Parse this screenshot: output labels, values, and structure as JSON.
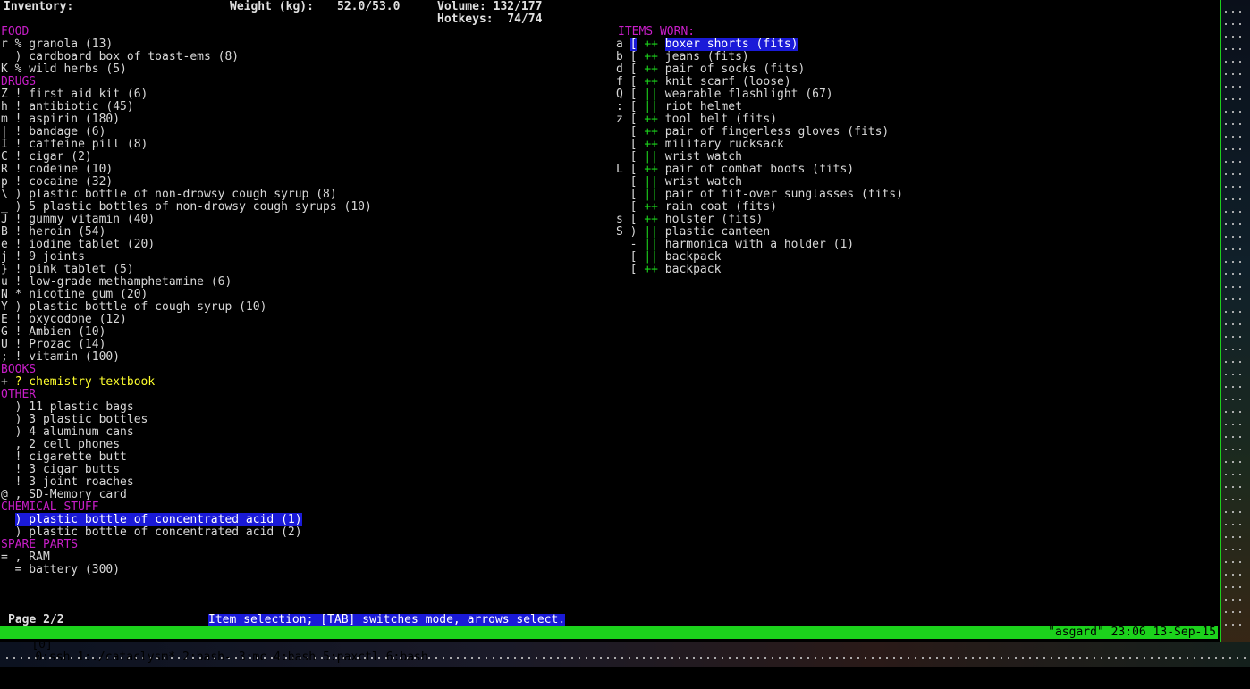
{
  "header": {
    "title": "Inventory:",
    "weight_label": "Weight (kg):",
    "weight_value": "52.0/53.0",
    "volume": "Volume: 132/177",
    "hotkeys": "Hotkeys:  74/74"
  },
  "left_lines": [
    {
      "type": "cat",
      "text": "FOOD"
    },
    {
      "type": "item",
      "text": "r % granola (13)"
    },
    {
      "type": "item",
      "text": "  ) cardboard box of toast-ems (8)"
    },
    {
      "type": "item",
      "text": "K % wild herbs (5)"
    },
    {
      "type": "cat",
      "text": "DRUGS"
    },
    {
      "type": "item",
      "text": "Z ! first aid kit (6)"
    },
    {
      "type": "item",
      "text": "h ! antibiotic (45)"
    },
    {
      "type": "item",
      "text": "m ! aspirin (180)"
    },
    {
      "type": "item",
      "text": "| ! bandage (6)"
    },
    {
      "type": "item",
      "text": "I ! caffeine pill (8)"
    },
    {
      "type": "item",
      "text": "C ! cigar (2)"
    },
    {
      "type": "item",
      "text": "R ! codeine (10)"
    },
    {
      "type": "item",
      "text": "p ! cocaine (32)"
    },
    {
      "type": "item",
      "text": "\\ ) plastic bottle of non-drowsy cough syrup (8)"
    },
    {
      "type": "item",
      "text": "_ ) 5 plastic bottles of non-drowsy cough syrups (10)"
    },
    {
      "type": "item",
      "text": "J ! gummy vitamin (40)"
    },
    {
      "type": "item",
      "text": "B ! heroin (54)"
    },
    {
      "type": "item",
      "text": "e ! iodine tablet (20)"
    },
    {
      "type": "item",
      "text": "j ! 9 joints"
    },
    {
      "type": "item",
      "text": "} ! pink tablet (5)"
    },
    {
      "type": "item",
      "text": "u ! low-grade methamphetamine (6)"
    },
    {
      "type": "item",
      "text": "N * nicotine gum (20)"
    },
    {
      "type": "item",
      "text": "Y ) plastic bottle of cough syrup (10)"
    },
    {
      "type": "item",
      "text": "E ! oxycodone (12)"
    },
    {
      "type": "item",
      "text": "G ! Ambien (10)"
    },
    {
      "type": "item",
      "text": "U ! Prozac (14)"
    },
    {
      "type": "item",
      "text": "; ! vitamin (100)"
    },
    {
      "type": "cat",
      "text": "BOOKS"
    },
    {
      "type": "book",
      "prefix": "+ ",
      "sym": "?",
      "name": " chemistry textbook"
    },
    {
      "type": "cat",
      "text": "OTHER"
    },
    {
      "type": "item",
      "text": "  ) 11 plastic bags"
    },
    {
      "type": "item",
      "text": "  ) 3 plastic bottles"
    },
    {
      "type": "item",
      "text": "  ) 4 aluminum cans"
    },
    {
      "type": "item",
      "text": "  , 2 cell phones"
    },
    {
      "type": "item",
      "text": "  ! cigarette butt"
    },
    {
      "type": "item",
      "text": "  ! 3 cigar butts"
    },
    {
      "type": "item",
      "text": "  ! 3 joint roaches"
    },
    {
      "type": "item",
      "text": "@ , SD-Memory card"
    },
    {
      "type": "cat",
      "text": "CHEMICAL STUFF"
    },
    {
      "type": "selected",
      "prefix": "  ",
      "text": ") plastic bottle of concentrated acid (1)"
    },
    {
      "type": "item",
      "text": "  ) plastic bottle of concentrated acid (2)"
    },
    {
      "type": "cat",
      "text": "SPARE PARTS"
    },
    {
      "type": "item",
      "text": "= , RAM"
    },
    {
      "type": "item",
      "text": "  = battery (300)"
    }
  ],
  "worn": {
    "title": "ITEMS WORN:",
    "items": [
      {
        "key": "a",
        "sym": "[",
        "mark": "++",
        "name": "boxer shorts (fits)",
        "selected": true
      },
      {
        "key": "b",
        "sym": "[",
        "mark": "++",
        "name": "jeans (fits)"
      },
      {
        "key": "d",
        "sym": "[",
        "mark": "++",
        "name": "pair of socks (fits)"
      },
      {
        "key": "f",
        "sym": "[",
        "mark": "++",
        "name": "knit scarf (loose)"
      },
      {
        "key": "Q",
        "sym": "[",
        "mark": "||",
        "name": "wearable flashlight (67)"
      },
      {
        "key": ":",
        "sym": "[",
        "mark": "||",
        "name": "riot helmet"
      },
      {
        "key": "z",
        "sym": "[",
        "mark": "++",
        "name": "tool belt (fits)"
      },
      {
        "key": " ",
        "sym": "[",
        "mark": "++",
        "name": "pair of fingerless gloves (fits)"
      },
      {
        "key": " ",
        "sym": "[",
        "mark": "++",
        "name": "military rucksack"
      },
      {
        "key": " ",
        "sym": "[",
        "mark": "||",
        "name": "wrist watch"
      },
      {
        "key": "L",
        "sym": "[",
        "mark": "++",
        "name": "pair of combat boots (fits)"
      },
      {
        "key": " ",
        "sym": "[",
        "mark": "||",
        "name": "wrist watch"
      },
      {
        "key": " ",
        "sym": "[",
        "mark": "||",
        "name": "pair of fit-over sunglasses (fits)"
      },
      {
        "key": " ",
        "sym": "[",
        "mark": "++",
        "name": "rain coat (fits)"
      },
      {
        "key": "s",
        "sym": "[",
        "mark": "++",
        "name": "holster (fits)"
      },
      {
        "key": "S",
        "sym": ")",
        "mark": "||",
        "name": "plastic canteen"
      },
      {
        "key": " ",
        "sym": "-",
        "mark": "||",
        "name": "harmonica with a holder (1)"
      },
      {
        "key": " ",
        "sym": "[",
        "mark": "||",
        "name": "backpack"
      },
      {
        "key": " ",
        "sym": "[",
        "mark": "++",
        "name": "backpack"
      }
    ]
  },
  "footer": {
    "page": "Page 2/2",
    "hint": "Item selection; [TAB] switches mode, arrows select."
  },
  "tmux": {
    "session": "[0]",
    "windows": [
      "0:ssh",
      "1:./cataclysm*",
      "2:bash-",
      "3:mc",
      "4:bash",
      "5:paxctl",
      "6:bash"
    ],
    "right": "\"asgard\" 23:06 13-Sep-15"
  },
  "colors": {
    "category": "#c81ec8",
    "selection": "#1a1ad8",
    "status_bar": "#1cd21c",
    "book": "#ffff2e",
    "worn_mark": "#1cd21c"
  }
}
